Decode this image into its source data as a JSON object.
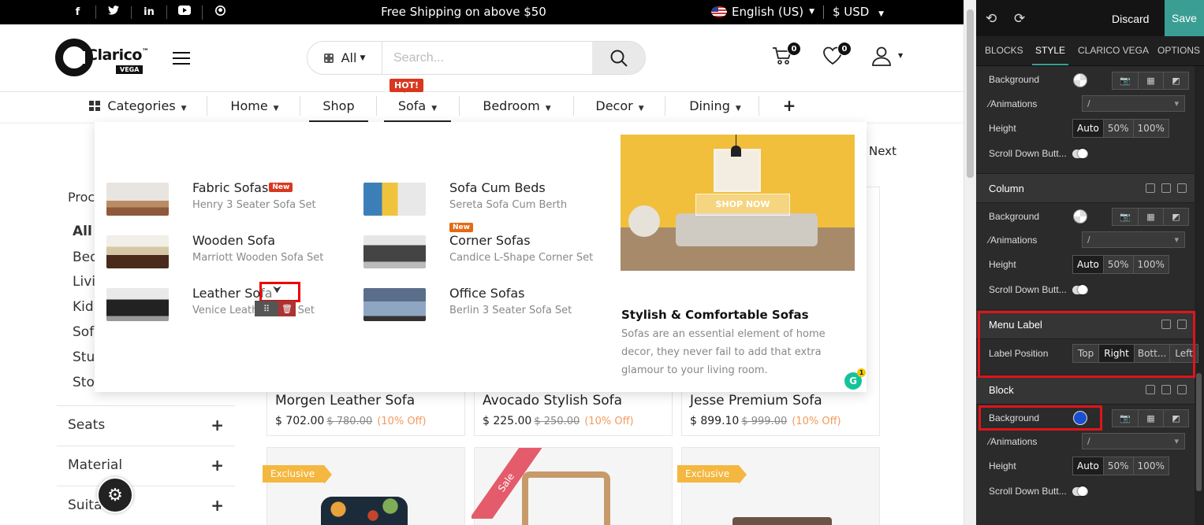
{
  "topbar": {
    "socials": [
      "f",
      "t",
      "in",
      "▶",
      "gh"
    ],
    "shipping": "Free Shipping on above $50",
    "language": "English (US)",
    "currency": "$ USD"
  },
  "header": {
    "logo_name": "Clarico",
    "logo_tm": "™",
    "logo_sub": "VEGA",
    "search_category": "All",
    "search_placeholder": "Search...",
    "cart_count": "0",
    "wishlist_count": "0"
  },
  "nav": {
    "items": [
      "Categories",
      "Home",
      "Shop",
      "Sofa",
      "Bedroom",
      "Decor",
      "Dining",
      "+"
    ],
    "hot_label": "HOT!"
  },
  "mega": {
    "items": [
      {
        "title": "Fabric Sofas",
        "tag": "New",
        "sub": "Henry 3 Seater Sofa Set"
      },
      {
        "title": "Sofa Cum Beds",
        "tag": "",
        "sub": "Sereta Sofa Cum Berth"
      },
      {
        "title": "Wooden Sofa",
        "tag": "",
        "sub": "Marriott Wooden Sofa Set"
      },
      {
        "title": "Corner Sofas",
        "tag": "New",
        "sub": "Candice L-Shape Corner Set"
      },
      {
        "title": "Leather Sofa",
        "tag": "",
        "sub": "Venice Leather Sofa Set"
      },
      {
        "title": "Office Sofas",
        "tag": "",
        "sub": "Berlin 3 Seater Sofa Set"
      }
    ],
    "promo_button": "SHOP NOW",
    "promo_title": "Stylish & Comfortable Sofas",
    "promo_desc": "Sofas are an essential element of home decor, they never fail to add that extra glamour to your living room.",
    "grammarly_count": "1"
  },
  "page": {
    "next": "Next",
    "filter_title": "Proc",
    "categories": [
      "All",
      "Bed",
      "Livi",
      "Kid",
      "Sofa",
      "Stu",
      "Sto"
    ],
    "filter_sections": [
      "Seats",
      "Material",
      "Suita...or"
    ],
    "products": [
      {
        "name": "Morgen Leather Sofa",
        "price": "$ 702.00",
        "old": "$ 780.00",
        "off": "(10% Off)"
      },
      {
        "name": "Avocado Stylish Sofa",
        "price": "$ 225.00",
        "old": "$ 250.00",
        "off": "(10% Off)"
      },
      {
        "name": "Jesse Premium Sofa",
        "price": "$ 899.10",
        "old": "$ 999.00",
        "off": "(10% Off)"
      }
    ],
    "ribbons": [
      "Exclusive",
      "Sale",
      "Exclusive"
    ]
  },
  "editor": {
    "discard": "Discard",
    "save": "Save",
    "tabs": [
      "BLOCKS",
      "STYLE",
      "CLARICO VEGA",
      "OPTIONS"
    ],
    "active_tab": "STYLE",
    "labels": {
      "background": "Background",
      "animations": "Animations",
      "height": "Height",
      "scroll_down": "Scroll Down Butt...",
      "column": "Column",
      "menu_label": "Menu Label",
      "label_position": "Label Position",
      "block": "Block",
      "select_value": "/"
    },
    "height_options": [
      "Auto",
      "50%",
      "100%"
    ],
    "label_positions": [
      "Top",
      "Right",
      "Bott...",
      "Left"
    ],
    "active_label_position": "Right",
    "block_background_color": "#1a4fd1",
    "accent_color": "#3a9e94"
  }
}
